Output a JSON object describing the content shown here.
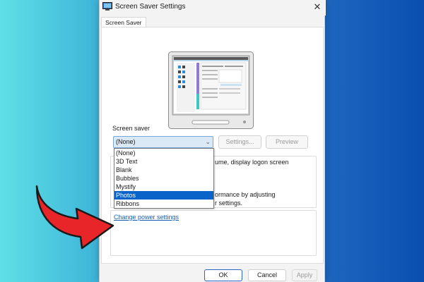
{
  "window": {
    "title": "Screen Saver Settings",
    "close_glyph": "✕"
  },
  "tabs": [
    {
      "label": "Screen Saver"
    }
  ],
  "screen_saver": {
    "group_label": "Screen saver",
    "selected": "(None)",
    "settings_button": "Settings...",
    "preview_button": "Preview",
    "logon_text": "ume, display logon screen",
    "options": [
      "(None)",
      "3D Text",
      "Blank",
      "Bubbles",
      "Mystify",
      "Photos",
      "Ribbons"
    ],
    "highlighted_option": "Photos"
  },
  "power": {
    "line1": "ormance by adjusting",
    "line2": "r settings.",
    "link": "Change power settings"
  },
  "footer": {
    "ok": "OK",
    "cancel": "Cancel",
    "apply": "Apply"
  },
  "icons": {
    "window_icon": "monitor-icon",
    "close": "close-icon",
    "chevron": "chevron-down-icon",
    "annotation": "red-arrow-icon"
  },
  "colors": {
    "accent": "#0a63c8",
    "arrow": "#e8262a",
    "link": "#1a5fb4"
  }
}
